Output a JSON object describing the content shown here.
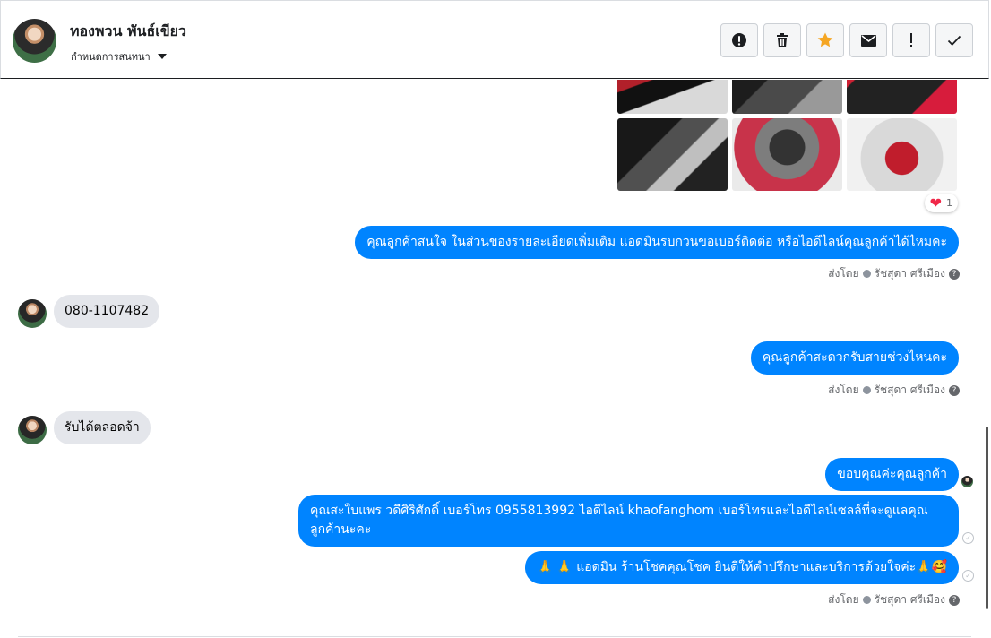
{
  "header": {
    "contact_name": "ทองพวน พันธ์เขียว",
    "assign_label": "กำหนดการสนทนา",
    "toolbar": {
      "alert_icon": "alert-circle-icon",
      "delete_icon": "trash-icon",
      "star_icon": "star-icon",
      "mail_icon": "envelope-icon",
      "mark_icon": "exclamation-icon",
      "done_icon": "check-icon"
    }
  },
  "reaction": {
    "emoji": "❤",
    "count": "1"
  },
  "messages": {
    "request_info": "คุณลูกค้าสนใจ ในส่วนของรายละเอียดเพิ่มเติม แอดมินรบกวนขอเบอร์ติดต่อ หรือไอดีไลน์คุณลูกค้าได้ไหมคะ",
    "phone": "080-1107482",
    "call_time": "คุณลูกค้าสะดวกรับสายช่วงไหนคะ",
    "anytime": "รับได้ตลอดจ้า",
    "thanks": "ขอบคุณค่ะคุณลูกค้า",
    "contact_info": "คุณสะใบแพร วดีศิริศักดิ์ เบอร์โทร 0955813992  ไอดีไลน์  khaofanghom  เบอร์โทรและไอดีไลน์เซลล์ที่จะดูแลคุณลูกค้านะคะ",
    "closing": "🙏 🙏 แอดมิน ร้านโชคคุณโชค ยินดีให้คำปรึกษาและบริการด้วยใจค่ะ🙏🥰"
  },
  "meta": {
    "sent_by": "ส่งโดย",
    "agent": "รัชสุดา ศรีเมือง",
    "help": "?"
  },
  "colors": {
    "outgoing": "#0084ff",
    "incoming": "#e4e6eb",
    "star": "#f5a623"
  }
}
